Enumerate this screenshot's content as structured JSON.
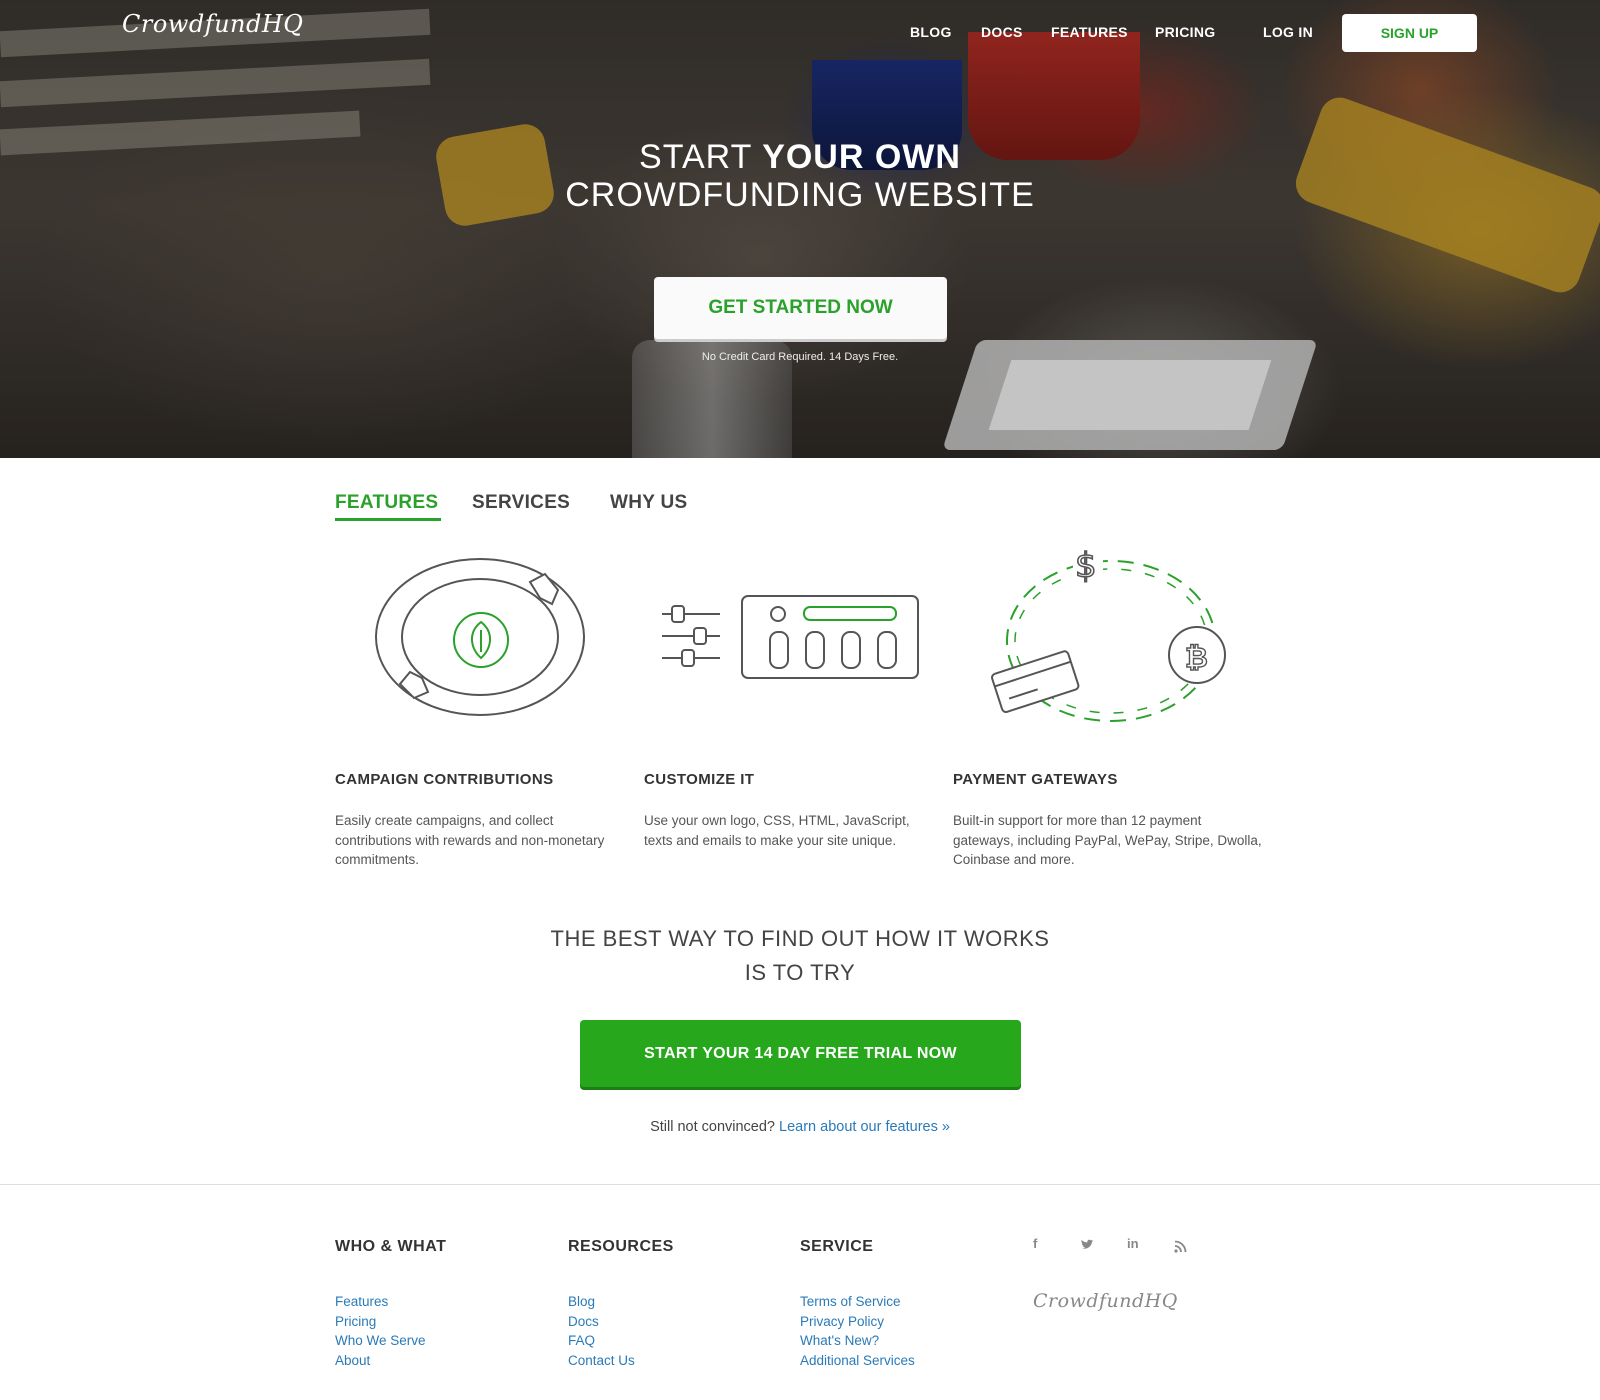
{
  "brand": {
    "logo_text": "CrowdfundHQ"
  },
  "nav": {
    "items": [
      {
        "label": "BLOG"
      },
      {
        "label": "DOCS"
      },
      {
        "label": "FEATURES"
      },
      {
        "label": "PRICING"
      },
      {
        "label": "LOG IN"
      }
    ],
    "signup_label": "SIGN UP"
  },
  "hero": {
    "title_light_1": "START",
    "title_bold": "YOUR OWN",
    "title_line_2": "CROWDFUNDING WEBSITE",
    "cta_label": "GET STARTED NOW",
    "note": "No Credit Card Required. 14 Days Free."
  },
  "tabs": [
    {
      "label": "FEATURES",
      "active": true
    },
    {
      "label": "SERVICES",
      "active": false
    },
    {
      "label": "WHY US",
      "active": false
    }
  ],
  "features": [
    {
      "title": "CAMPAIGN CONTRIBUTIONS",
      "description": "Easily create campaigns, and collect contributions with rewards and non-monetary commitments.",
      "icon": "coin-hands-icon"
    },
    {
      "title": "CUSTOMIZE IT",
      "description": "Use your own logo, CSS, HTML, JavaScript, texts and emails to make your site unique.",
      "icon": "sliders-panel-icon"
    },
    {
      "title": "PAYMENT GATEWAYS",
      "description": "Built-in support for more than 12 payment gateways, including PayPal, WePay, Stripe, Dwolla, Coinbase and more.",
      "icon": "payment-cycle-icon"
    }
  ],
  "try_section": {
    "title_line_1": "THE BEST WAY TO FIND OUT HOW IT WORKS",
    "title_line_2": "IS TO TRY",
    "cta_label": "START YOUR 14 DAY FREE TRIAL NOW",
    "still_text": "Still not convinced?",
    "learn_link": "Learn about our features »"
  },
  "footer": {
    "columns": [
      {
        "heading": "WHO & WHAT",
        "links": [
          "Features",
          "Pricing",
          "Who We Serve",
          "About"
        ]
      },
      {
        "heading": "RESOURCES",
        "links": [
          "Blog",
          "Docs",
          "FAQ",
          "Contact Us"
        ]
      },
      {
        "heading": "SERVICE",
        "links": [
          "Terms of Service",
          "Privacy Policy",
          "What's New?",
          "Additional Services"
        ]
      }
    ],
    "social": [
      {
        "icon": "facebook-icon",
        "glyph": "f"
      },
      {
        "icon": "twitter-icon",
        "glyph": "t"
      },
      {
        "icon": "linkedin-icon",
        "glyph": "in"
      },
      {
        "icon": "rss-icon",
        "glyph": "))"
      }
    ],
    "logo_text": "CrowdfundHQ"
  },
  "colors": {
    "accent": "#2aa12a",
    "link": "#2a7ab8",
    "trial_button": "#27a81c"
  }
}
